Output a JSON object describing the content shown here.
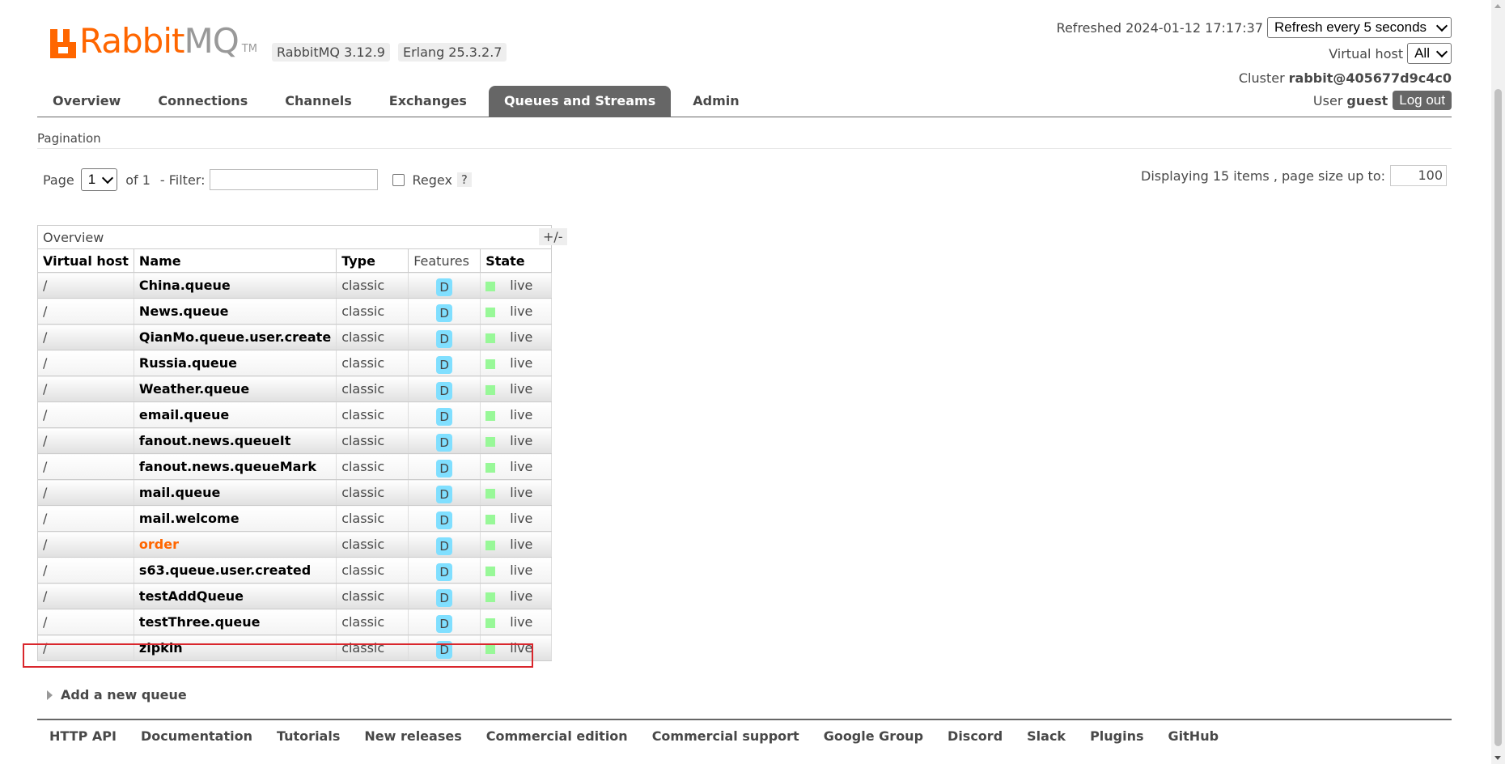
{
  "header": {
    "brand_primary": "Rabbit",
    "brand_secondary": "MQ",
    "trademark": "TM",
    "version": "RabbitMQ 3.12.9",
    "erlang": "Erlang 25.3.2.7",
    "refreshed_label": "Refreshed 2024-01-12 17:17:37",
    "refresh_option": "Refresh every 5 seconds",
    "vhost_label": "Virtual host",
    "vhost_value": "All",
    "cluster_label": "Cluster",
    "cluster_value": "rabbit@405677d9c4c0",
    "user_label": "User",
    "user_value": "guest",
    "logout": "Log out"
  },
  "tabs": [
    {
      "label": "Overview",
      "active": false
    },
    {
      "label": "Connections",
      "active": false
    },
    {
      "label": "Channels",
      "active": false
    },
    {
      "label": "Exchanges",
      "active": false
    },
    {
      "label": "Queues and Streams",
      "active": true
    },
    {
      "label": "Admin",
      "active": false
    }
  ],
  "pagination": {
    "section_title": "Pagination",
    "page_label": "Page",
    "page_value": "1",
    "of_label": "of 1",
    "filter_label": "- Filter:",
    "filter_value": "",
    "regex_label": "Regex",
    "help": "?",
    "display_label": "Displaying 15 items , page size up to:",
    "page_size": "100"
  },
  "table": {
    "group_header": "Overview",
    "toggle": "+/-",
    "columns": [
      "Virtual host",
      "Name",
      "Type",
      "Features",
      "State"
    ],
    "rows": [
      {
        "vhost": "/",
        "name": "China.queue",
        "type": "classic",
        "feature": "D",
        "state": "live"
      },
      {
        "vhost": "/",
        "name": "News.queue",
        "type": "classic",
        "feature": "D",
        "state": "live"
      },
      {
        "vhost": "/",
        "name": "QianMo.queue.user.create",
        "type": "classic",
        "feature": "D",
        "state": "live"
      },
      {
        "vhost": "/",
        "name": "Russia.queue",
        "type": "classic",
        "feature": "D",
        "state": "live"
      },
      {
        "vhost": "/",
        "name": "Weather.queue",
        "type": "classic",
        "feature": "D",
        "state": "live"
      },
      {
        "vhost": "/",
        "name": "email.queue",
        "type": "classic",
        "feature": "D",
        "state": "live"
      },
      {
        "vhost": "/",
        "name": "fanout.news.queueIt",
        "type": "classic",
        "feature": "D",
        "state": "live"
      },
      {
        "vhost": "/",
        "name": "fanout.news.queueMark",
        "type": "classic",
        "feature": "D",
        "state": "live"
      },
      {
        "vhost": "/",
        "name": "mail.queue",
        "type": "classic",
        "feature": "D",
        "state": "live"
      },
      {
        "vhost": "/",
        "name": "mail.welcome",
        "type": "classic",
        "feature": "D",
        "state": "live"
      },
      {
        "vhost": "/",
        "name": "order",
        "type": "classic",
        "feature": "D",
        "state": "live"
      },
      {
        "vhost": "/",
        "name": "s63.queue.user.created",
        "type": "classic",
        "feature": "D",
        "state": "live"
      },
      {
        "vhost": "/",
        "name": "testAddQueue",
        "type": "classic",
        "feature": "D",
        "state": "live"
      },
      {
        "vhost": "/",
        "name": "testThree.queue",
        "type": "classic",
        "feature": "D",
        "state": "live"
      },
      {
        "vhost": "/",
        "name": "zipkin",
        "type": "classic",
        "feature": "D",
        "state": "live"
      }
    ]
  },
  "add_queue": "Add a new queue",
  "footer": [
    "HTTP API",
    "Documentation",
    "Tutorials",
    "New releases",
    "Commercial edition",
    "Commercial support",
    "Google Group",
    "Discord",
    "Slack",
    "Plugins",
    "GitHub"
  ],
  "colors": {
    "brand": "#ff6600",
    "active_tab": "#666666",
    "feature_badge": "#80dfff",
    "state_live": "#98f898",
    "highlight_box": "#d9262c"
  }
}
